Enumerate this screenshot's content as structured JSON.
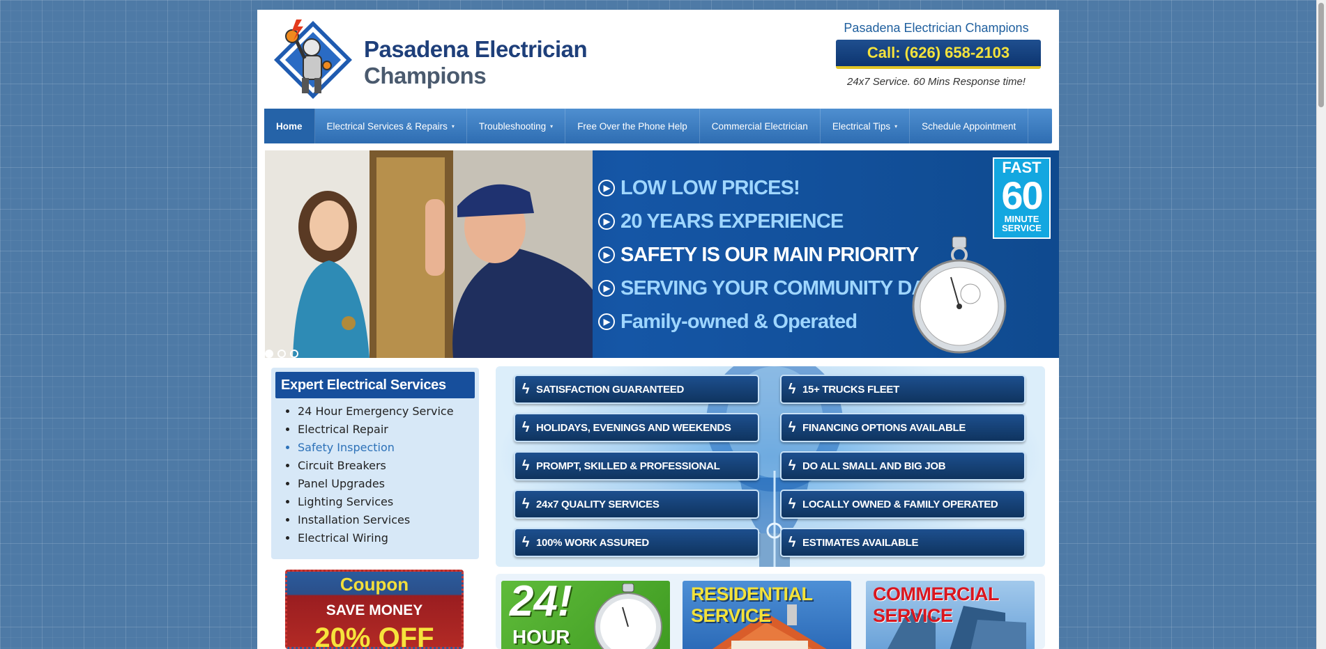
{
  "header": {
    "logo_line1": "Pasadena Electrician",
    "logo_line2": "Champions",
    "company_name": "Pasadena Electrician Champions",
    "call_label": "Call: (626) 658-2103",
    "tagline": "24x7 Service. 60 Mins Response time!"
  },
  "nav": {
    "items": [
      {
        "label": "Home",
        "active": true
      },
      {
        "label": "Electrical Services & Repairs",
        "dropdown": true
      },
      {
        "label": "Troubleshooting",
        "dropdown": true
      },
      {
        "label": "Free Over the Phone Help"
      },
      {
        "label": "Commercial Electrician"
      },
      {
        "label": "Electrical Tips",
        "dropdown": true
      },
      {
        "label": "Schedule Appointment"
      }
    ],
    "caret": "▾"
  },
  "banner": {
    "bullets": [
      {
        "text": "LOW LOW PRICES!"
      },
      {
        "text": "20 YEARS EXPERIENCE"
      },
      {
        "text": "SAFETY IS OUR MAIN PRIORITY"
      },
      {
        "text": "SERVING YOUR COMMUNITY DAILY"
      },
      {
        "text": "Family-owned & Operated"
      }
    ],
    "badge_top": "FAST",
    "badge_num": "60",
    "badge_sub1": "MINUTE",
    "badge_sub2": "SERVICE",
    "slide_count": 3,
    "active_slide": 1
  },
  "services": {
    "title": "Expert Electrical Services",
    "items": [
      "24 Hour Emergency Service",
      "Electrical Repair",
      "Safety Inspection",
      "Circuit Breakers",
      "Panel Upgrades",
      "Lighting Services",
      "Installation Services",
      "Electrical Wiring"
    ]
  },
  "coupon": {
    "title": "Coupon",
    "line": "SAVE MONEY",
    "percent": "20% OFF"
  },
  "features": {
    "left": [
      "SATISFACTION GUARANTEED",
      "HOLIDAYS, EVENINGS AND WEEKENDS",
      "PROMPT, SKILLED & PROFESSIONAL",
      "24x7 QUALITY SERVICES",
      "100% WORK ASSURED"
    ],
    "right": [
      "15+ TRUCKS FLEET",
      "FINANCING OPTIONS AVAILABLE",
      "DO ALL SMALL AND BIG JOB",
      "LOCALLY OWNED & FAMILY OPERATED",
      "ESTIMATES AVAILABLE"
    ]
  },
  "tiles": {
    "t1_num": "24!",
    "t1_hour": "HOUR",
    "t2_line1": "RESIDENTIAL",
    "t2_line2": "SERVICE",
    "t3_line1": "COMMERCIAL",
    "t3_line2": "SERVICE"
  },
  "colors": {
    "brand_blue": "#1e3f7a",
    "nav_blue": "#3a7cc2",
    "call_yellow": "#f5e33c",
    "link_blue": "#2c71b8"
  }
}
